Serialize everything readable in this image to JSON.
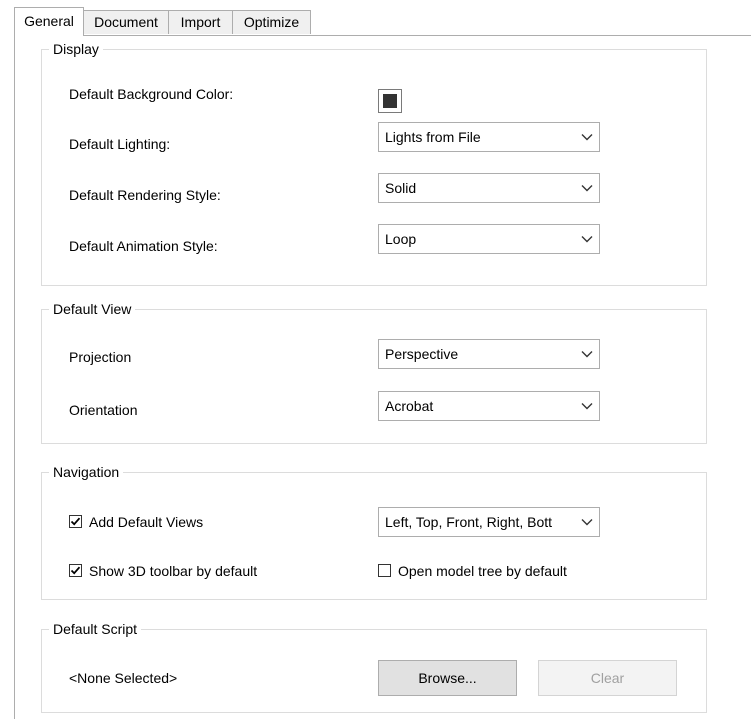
{
  "tabs": [
    {
      "label": "General",
      "active": true
    },
    {
      "label": "Document",
      "active": false
    },
    {
      "label": "Import",
      "active": false
    },
    {
      "label": "Optimize",
      "active": false
    }
  ],
  "display": {
    "title": "Display",
    "bg_color_label": "Default Background Color:",
    "bg_color_value": "#333333",
    "lighting_label": "Default Lighting:",
    "lighting_value": "Lights from File",
    "rendering_label": "Default Rendering Style:",
    "rendering_value": "Solid",
    "animation_label": "Default Animation Style:",
    "animation_value": "Loop"
  },
  "default_view": {
    "title": "Default View",
    "projection_label": "Projection",
    "projection_value": "Perspective",
    "orientation_label": "Orientation",
    "orientation_value": "Acrobat"
  },
  "navigation": {
    "title": "Navigation",
    "add_default_views_label": "Add Default Views",
    "add_default_views_checked": true,
    "views_value": "Left, Top, Front, Right, Bott",
    "show_toolbar_label": "Show 3D toolbar by default",
    "show_toolbar_checked": true,
    "open_model_tree_label": "Open model tree by default",
    "open_model_tree_checked": false
  },
  "default_script": {
    "title": "Default Script",
    "value": "<None Selected>",
    "browse_label": "Browse...",
    "clear_label": "Clear"
  }
}
